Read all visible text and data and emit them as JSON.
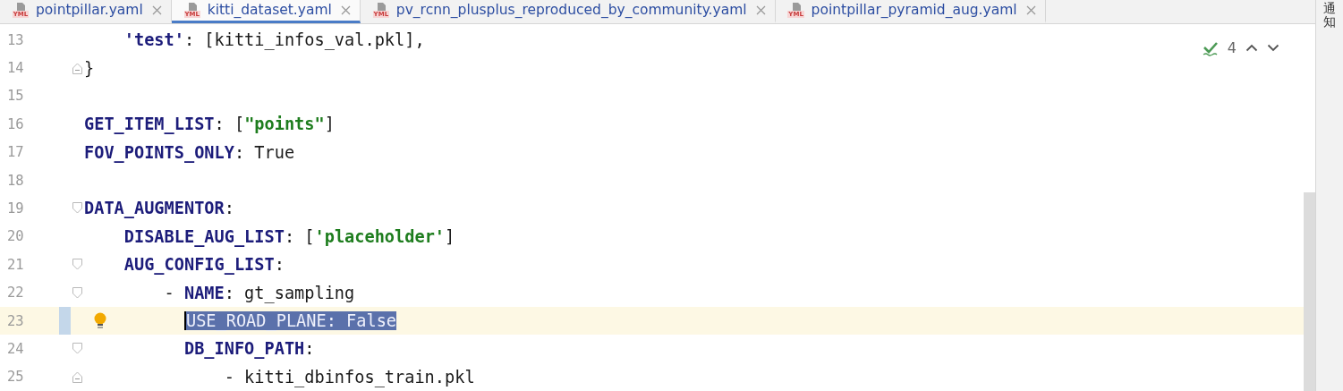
{
  "tabs": [
    {
      "label": "pointpillar.yaml",
      "icon_text": "YML",
      "selected": false
    },
    {
      "label": "kitti_dataset.yaml",
      "icon_text": "YML",
      "selected": true
    },
    {
      "label": "pv_rcnn_plusplus_reproduced_by_community.yaml",
      "icon_text": "YML",
      "selected": false
    },
    {
      "label": "pointpillar_pyramid_aug.yaml",
      "icon_text": "YML",
      "selected": false
    }
  ],
  "inspection": {
    "count": "4"
  },
  "side_panel": {
    "label": "通知"
  },
  "lines": [
    {
      "number": "13",
      "kind": "plain",
      "current": false,
      "tokens": [
        {
          "kind": "key",
          "text": "    'test'"
        },
        {
          "kind": "plain",
          "text": ": [kitti_infos_val.pkl],"
        }
      ]
    },
    {
      "number": "14",
      "kind": "fold_end",
      "current": false,
      "tokens": [
        {
          "kind": "plain",
          "text": "}"
        }
      ]
    },
    {
      "number": "15",
      "kind": "plain",
      "current": false
    },
    {
      "number": "16",
      "kind": "plain",
      "current": false,
      "tokens": [
        {
          "kind": "key",
          "text": "GET_ITEM_LIST"
        },
        {
          "kind": "plain",
          "text": ": ["
        },
        {
          "kind": "string",
          "text": "\"points\""
        },
        {
          "kind": "plain",
          "text": "]"
        }
      ]
    },
    {
      "number": "17",
      "kind": "plain",
      "current": false,
      "tokens": [
        {
          "kind": "key",
          "text": "FOV_POINTS_ONLY"
        },
        {
          "kind": "plain",
          "text": ": True"
        }
      ]
    },
    {
      "number": "18",
      "kind": "plain",
      "current": false
    },
    {
      "number": "19",
      "kind": "fold_start",
      "current": false,
      "tokens": [
        {
          "kind": "key",
          "text": "DATA_AUGMENTOR"
        },
        {
          "kind": "plain",
          "text": ":"
        }
      ]
    },
    {
      "number": "20",
      "kind": "plain",
      "current": false,
      "tokens": [
        {
          "kind": "key",
          "text": "    DISABLE_AUG_LIST"
        },
        {
          "kind": "plain",
          "text": ": ["
        },
        {
          "kind": "string",
          "text": "'placeholder'"
        },
        {
          "kind": "plain",
          "text": "]"
        }
      ]
    },
    {
      "number": "21",
      "kind": "fold_start",
      "current": false,
      "tokens": [
        {
          "kind": "key",
          "text": "    AUG_CONFIG_LIST"
        },
        {
          "kind": "plain",
          "text": ":"
        }
      ]
    },
    {
      "number": "22",
      "kind": "fold_start",
      "current": false,
      "tokens": [
        {
          "kind": "plain",
          "text": "        - "
        },
        {
          "kind": "key",
          "text": "NAME"
        },
        {
          "kind": "plain",
          "text": ": gt_sampling"
        }
      ]
    },
    {
      "number": "23",
      "kind": "plain",
      "current": true,
      "tokens": [
        {
          "kind": "selected",
          "text": "          USE_ROAD_PLANE: False"
        }
      ]
    },
    {
      "number": "24",
      "kind": "fold_start",
      "current": false,
      "tokens": [
        {
          "kind": "key",
          "text": "          DB_INFO_PATH"
        },
        {
          "kind": "plain",
          "text": ":"
        }
      ]
    },
    {
      "number": "25",
      "kind": "fold_end",
      "current": false,
      "tokens": [
        {
          "kind": "plain",
          "text": "              - kitti_dbinfos_train.pkl"
        }
      ]
    }
  ]
}
